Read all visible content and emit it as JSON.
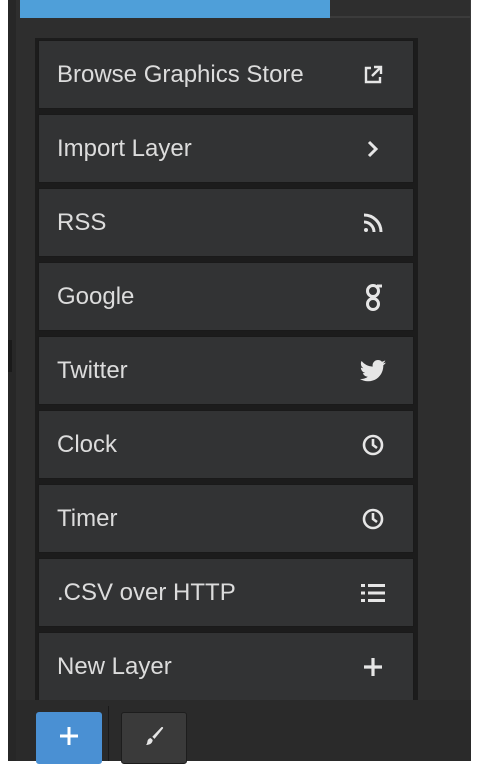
{
  "menu": {
    "items": [
      {
        "label": "Browse Graphics Store",
        "icon": "external-link-icon"
      },
      {
        "label": "Import Layer",
        "icon": "chevron-right-icon"
      },
      {
        "label": "RSS",
        "icon": "rss-icon"
      },
      {
        "label": "Google",
        "icon": "google-icon"
      },
      {
        "label": "Twitter",
        "icon": "twitter-icon"
      },
      {
        "label": "Clock",
        "icon": "clock-icon"
      },
      {
        "label": "Timer",
        "icon": "clock-icon"
      },
      {
        "label": ".CSV over HTTP",
        "icon": "list-icon"
      },
      {
        "label": "New Layer",
        "icon": "plus-icon"
      }
    ]
  },
  "toolbar": {
    "add_button": {
      "icon": "plus-icon"
    },
    "edit_button": {
      "icon": "brush-icon"
    }
  },
  "colors": {
    "accent": "#4a90d3",
    "menu_item_bg": "#323334",
    "panel_bg": "#2e2e2e",
    "text": "#dcdcdc"
  }
}
